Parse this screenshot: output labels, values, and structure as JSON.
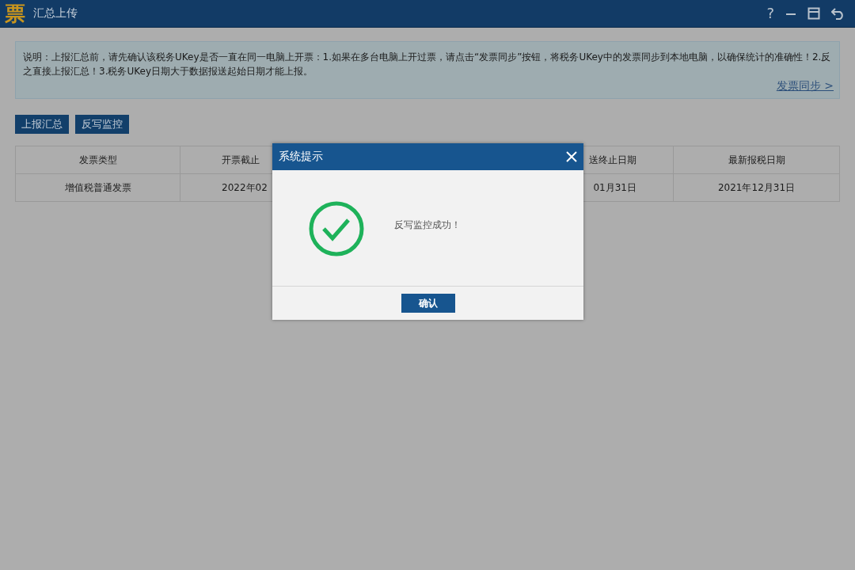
{
  "window": {
    "logo": "票",
    "title": "汇总上传",
    "controls": [
      "?"
    ]
  },
  "notice": {
    "text": "说明：上报汇总前，请先确认该税务UKey是否一直在同一电脑上开票：1.如果在多台电脑上开过票，请点击“发票同步”按钮，将税务UKey中的发票同步到本地电脑，以确保统计的准确性！2.反之直接上报汇总！3.税务UKey日期大于数据报送起始日期才能上报。",
    "link": "发票同步 >"
  },
  "toolbar": {
    "buttons": [
      "上报汇总",
      "反写监控"
    ]
  },
  "table": {
    "columns": [
      "发票类型",
      "开票截止",
      "送终止日期",
      "最新报税日期"
    ],
    "rows": [
      [
        "增值税普通发票",
        "2022年02",
        "01月31日",
        "2021年12月31日"
      ]
    ]
  },
  "dialog": {
    "title": "系统提示",
    "message": "反写监控成功！",
    "kind": "success",
    "buttons": [
      "确认"
    ]
  }
}
